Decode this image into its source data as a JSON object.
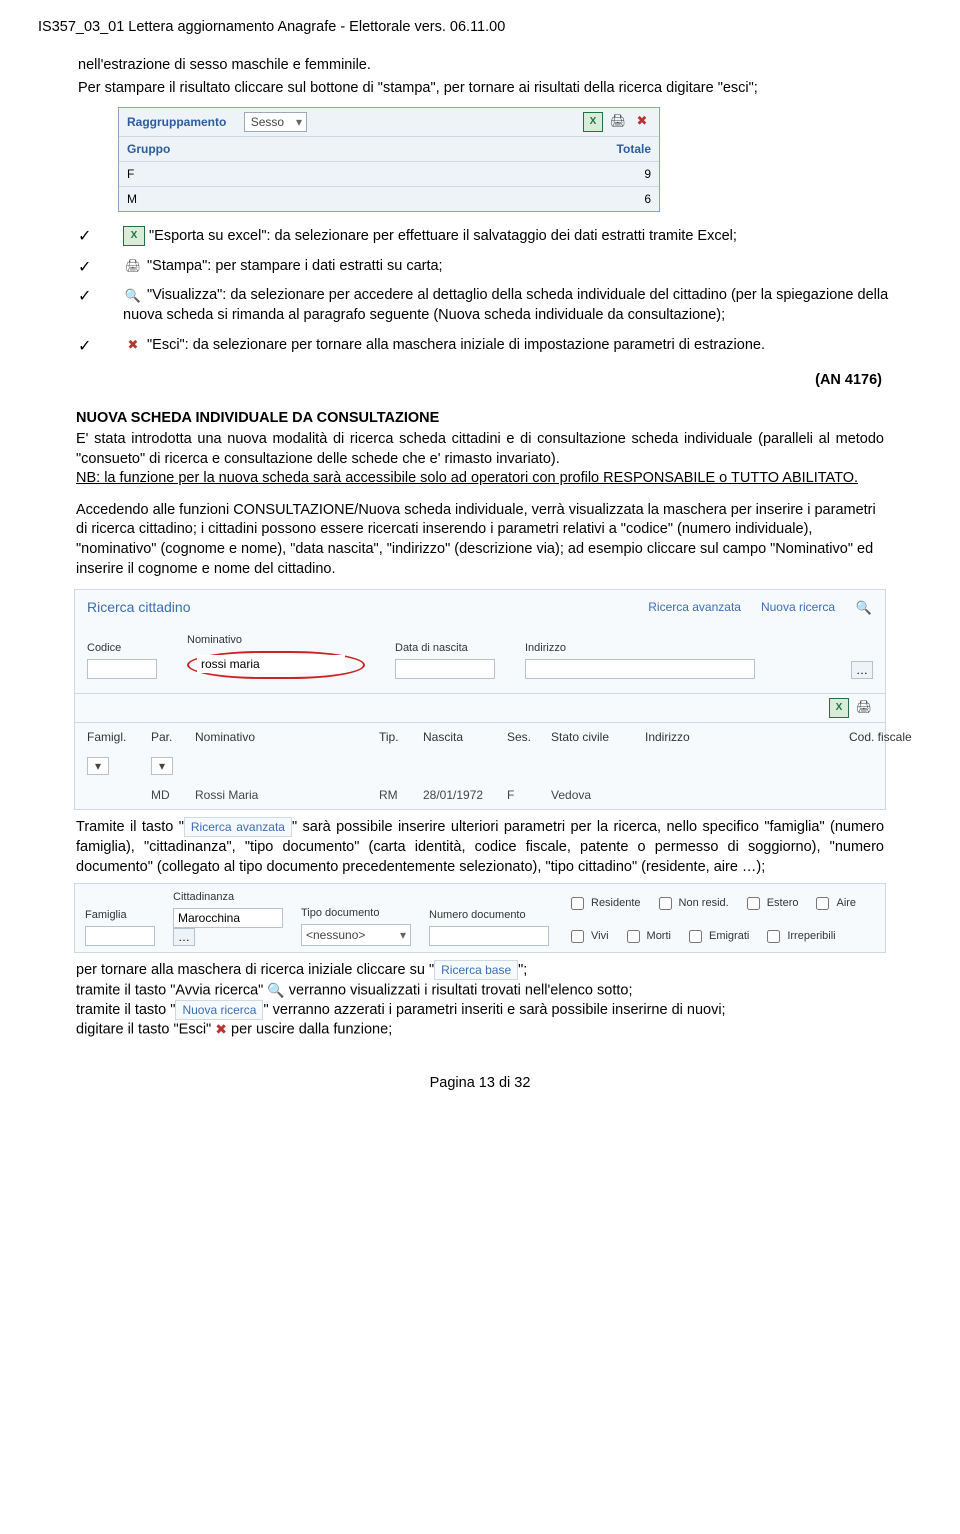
{
  "header_code": "IS357_03_01 Lettera aggiornamento Anagrafe - Elettorale vers. 06.11.00",
  "intro1": "nell'estrazione di sesso maschile e femminile.",
  "intro2": "Per stampare il risultato cliccare sul bottone di \"stampa\", per tornare ai risultati della ricerca digitare \"esci\";",
  "panel1": {
    "ragg_label": "Raggruppamento",
    "ragg_value": "Sesso",
    "col1": "Gruppo",
    "col2": "Totale",
    "rows": [
      {
        "g": "F",
        "t": "9"
      },
      {
        "g": "M",
        "t": "6"
      }
    ]
  },
  "check": {
    "excel": "\"Esporta su excel\": da selezionare per effettuare il salvataggio dei dati estratti tramite Excel;",
    "print": "\"Stampa\": per stampare i dati estratti su carta;",
    "view": "\"Visualizza\": da selezionare per accedere al dettaglio della scheda individuale del cittadino (per la spiegazione della nuova scheda si rimanda al paragrafo seguente (Nuova scheda individuale da consultazione);",
    "exit": "\"Esci\": da selezionare per tornare alla maschera iniziale di impostazione parametri di estrazione."
  },
  "ref": "(AN 4176)",
  "section_title": "NUOVA SCHEDA INDIVIDUALE DA CONSULTAZIONE",
  "para_a": "E' stata introdotta una nuova modalità di  ricerca scheda cittadini e di consultazione scheda individuale (paralleli al metodo \"consueto\" di ricerca e consultazione delle schede che e' rimasto invariato).",
  "para_b": "NB: la funzione per la nuova scheda sarà accessibile solo ad operatori con profilo RESPONSABILE o TUTTO ABILITATO.",
  "para_c": "Accedendo alle funzioni CONSULTAZIONE/Nuova scheda individuale, verrà visualizzata la maschera per inserire i parametri di ricerca cittadino; i cittadini possono essere ricercati inserendo i parametri relativi a \"codice\" (numero individuale), \"nominativo\" (cognome e nome), \"data nascita\", \"indirizzo\" (descrizione via); ad esempio cliccare sul campo \"Nominativo\" ed inserire il cognome e nome del cittadino.",
  "ricerca": {
    "title": "Ricerca cittadino",
    "link_adv": "Ricerca avanzata",
    "link_new": "Nuova ricerca",
    "codice": "Codice",
    "nominativo": "Nominativo",
    "nominativo_val": "rossi maria",
    "data": "Data di nascita",
    "indirizzo": "Indirizzo",
    "grid": {
      "h": [
        "Famigl.",
        "Par.",
        "Nominativo",
        "Tip.",
        "Nascita",
        "Ses.",
        "Stato civile",
        "Indirizzo",
        "Cod. fiscale"
      ],
      "row": [
        "",
        "MD",
        "Rossi Maria",
        "RM",
        "28/01/1972",
        "F",
        "Vedova",
        "",
        ""
      ]
    }
  },
  "tramite_pre": "Tramite il tasto \"",
  "ric_avz_btn": "Ricerca avanzata",
  "tramite_post": "\" sarà possibile inserire ulteriori parametri per la ricerca, nello specifico \"famiglia\" (numero famiglia), \"cittadinanza\", \"tipo documento\" (carta identità, codice fiscale, patente o permesso di soggiorno), \"numero documento\" (collegato al tipo documento precedentemente selezionato), \"tipo cittadino\" (residente, aire …);",
  "adv": {
    "famiglia": "Famiglia",
    "citt": "Cittadinanza",
    "citt_val": "Marocchina",
    "tipodoc": "Tipo documento",
    "tipodoc_val": "<nessuno>",
    "numdoc": "Numero documento",
    "chk": [
      "Residente",
      "Non resid.",
      "Estero",
      "Aire",
      "Vivi",
      "Morti",
      "Emigrati",
      "Irreperibili"
    ]
  },
  "after1_pre": "per tornare alla maschera di ricerca iniziale cliccare su \"",
  "ric_base_btn": "Ricerca base",
  "after1_post": "\";",
  "after2": "tramite il tasto \"Avvia ricerca\"  verranno visualizzati i risultati trovati nell'elenco sotto;",
  "after3_pre": "tramite il tasto \"",
  "nuova_ric_btn": "Nuova ricerca",
  "after3_post": "\" verranno azzerati i parametri inseriti e sarà possibile inserirne di nuovi;",
  "after4": "digitare il tasto \"Esci\"  per uscire dalla funzione;",
  "footer": "Pagina 13 di 32"
}
